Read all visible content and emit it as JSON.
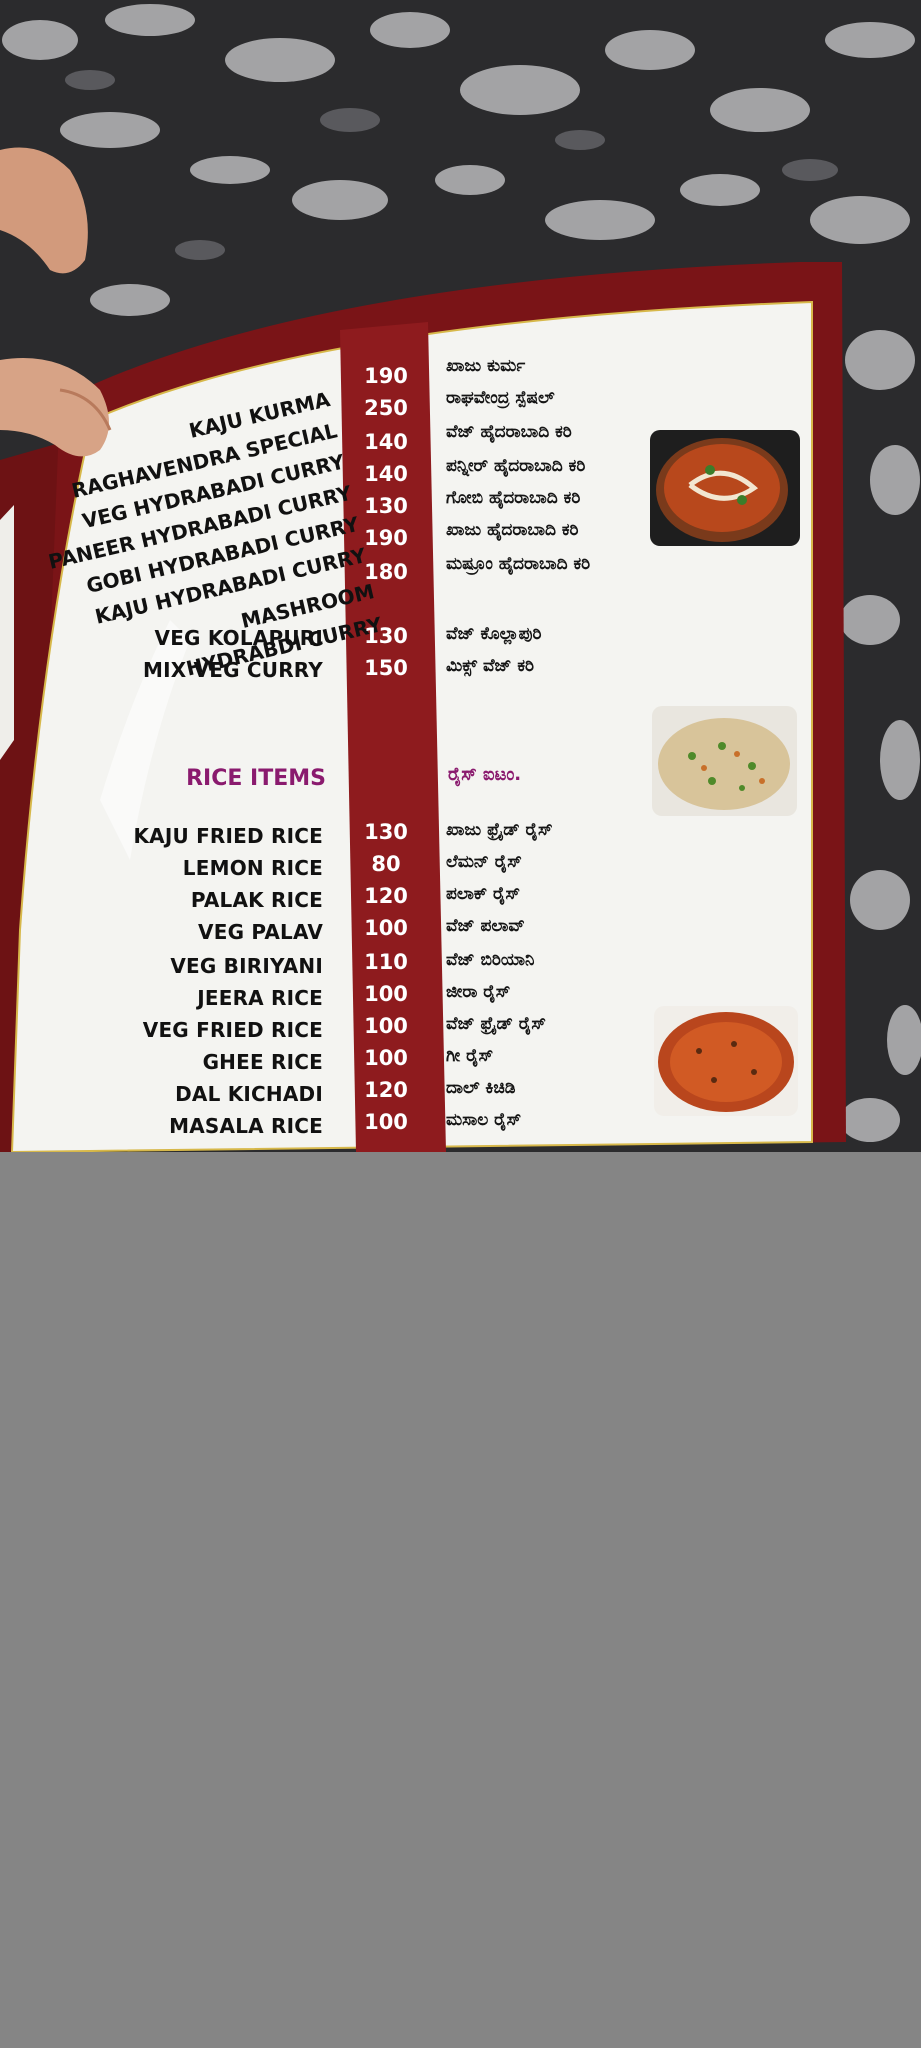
{
  "menu": {
    "curries": [
      {
        "name": "KAJU KURMA",
        "price": "190",
        "kannada": "ಖಾಜು ಕುರ್ಮ"
      },
      {
        "name": "RAGHAVENDRA SPECIAL",
        "price": "250",
        "kannada": "ರಾಘವೇಂದ್ರ ಸ್ಪೆಷಲ್"
      },
      {
        "name": "VEG HYDRABADI CURRY",
        "price": "140",
        "kannada": "ವೆಜ್ ಹೈದರಾಬಾದಿ ಕರಿ"
      },
      {
        "name": "PANEER HYDRABADI CURRY",
        "price": "140",
        "kannada": "ಪನ್ನೀರ್ ಹೈದರಾಬಾದಿ ಕರಿ"
      },
      {
        "name": "GOBI HYDRABADI CURRY",
        "price": "130",
        "kannada": "ಗೋಬಿ ಹೈದರಾಬಾದಿ ಕರಿ"
      },
      {
        "name": "KAJU HYDRABADI CURRY",
        "price": "190",
        "kannada": "ಖಾಜು ಹೈದರಾಬಾದಿ ಕರಿ"
      },
      {
        "name": "MASHROOM HYDRABDI CURRY",
        "price": "180",
        "kannada": "ಮಷ್ರೂಂ ಹೈದರಾಬಾದಿ ಕರಿ"
      },
      {
        "name": "VEG KOLAPURI",
        "price": "130",
        "kannada": "ವೆಜ್ ಕೊಲ್ಲಾಪುರಿ"
      },
      {
        "name": "MIX VEG CURRY",
        "price": "150",
        "kannada": "ಮಿಕ್ಸ್ ವೆಜ್ ಕರಿ"
      }
    ],
    "rice_heading_en": "RICE ITEMS",
    "rice_heading_kn": "ರೈಸ್ ಐಟಂ.",
    "rice": [
      {
        "name": "KAJU FRIED RICE",
        "price": "130",
        "kannada": "ಖಾಜು ಫ್ರೈಡ್ ರೈಸ್"
      },
      {
        "name": "LEMON RICE",
        "price": "80",
        "kannada": "ಲೆಮನ್ ರೈಸ್"
      },
      {
        "name": "PALAK RICE",
        "price": "120",
        "kannada": "ಪಲಾಕ್ ರೈಸ್"
      },
      {
        "name": "VEG PALAV",
        "price": "100",
        "kannada": "ವೆಜ್ ಪಲಾವ್"
      },
      {
        "name": "VEG BIRIYANI",
        "price": "110",
        "kannada": "ವೆಜ್ ಬಿರಿಯಾನಿ"
      },
      {
        "name": "JEERA RICE",
        "price": "100",
        "kannada": "ಜೀರಾ ರೈಸ್"
      },
      {
        "name": "VEG FRIED RICE",
        "price": "100",
        "kannada": "ವೆಜ್ ಫ್ರೈಡ್ ರೈಸ್"
      },
      {
        "name": "GHEE RICE",
        "price": "100",
        "kannada": "ಗೀ ರೈಸ್"
      },
      {
        "name": "DAL KICHADI",
        "price": "120",
        "kannada": "ದಾಲ್ ಕಿಚಿಡಿ"
      },
      {
        "name": "MASALA RICE",
        "price": "100",
        "kannada": "ಮಸಾಲ ರೈಸ್"
      }
    ]
  },
  "colors": {
    "cover": "#7a1417",
    "price_band": "#8e1b1e",
    "page": "#f4f4f1",
    "heading": "#8a1a6e",
    "gray_fill": "#858585"
  }
}
